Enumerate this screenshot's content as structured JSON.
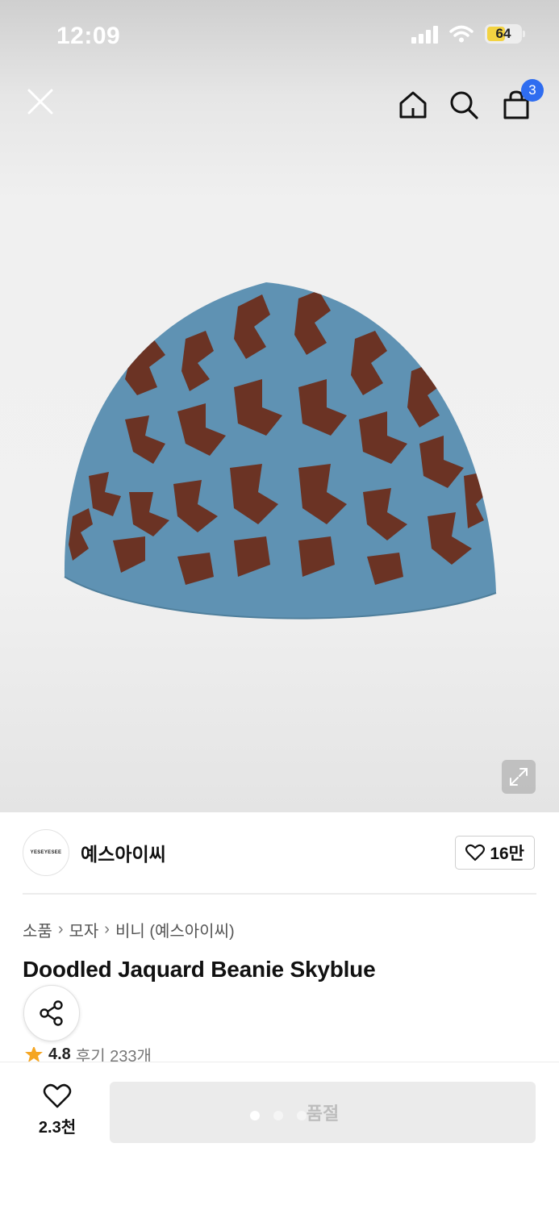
{
  "status_bar": {
    "time": "12:09",
    "battery": "64"
  },
  "header": {
    "close_icon": "close-icon",
    "home_icon": "home-icon",
    "search_icon": "search-icon",
    "bag_icon": "shopping-bag-icon",
    "cart_count": "3"
  },
  "product_image": {
    "alt": "Blue knit beanie with brown doodle pattern",
    "colors": {
      "knit": "#5f92b3",
      "pattern": "#6b3324"
    },
    "expand_icon": "expand-icon",
    "page_indicator": {
      "total": 3,
      "active": 1
    }
  },
  "brand": {
    "logo_text": "YESEYESEE",
    "name": "예스아이씨",
    "like_count": "16만"
  },
  "breadcrumb": [
    "소품",
    "모자",
    "비니 (예스아이씨)"
  ],
  "product": {
    "title": "Doodled Jaquard Beanie Skyblue",
    "share_icon": "share-icon",
    "rating": "4.8",
    "reviews": "후기 233개"
  },
  "bottom_bar": {
    "wish_count": "2.3천",
    "soldout_label": "품절"
  }
}
